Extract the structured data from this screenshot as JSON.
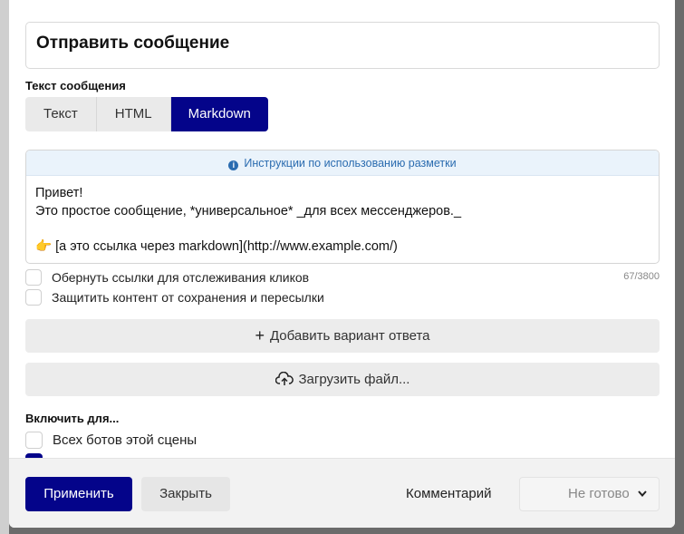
{
  "dialog": {
    "title": "Отправить сообщение"
  },
  "message": {
    "section_label": "Текст сообщения",
    "format_tabs": [
      {
        "label": "Текст",
        "active": false
      },
      {
        "label": "HTML",
        "active": false
      },
      {
        "label": "Markdown",
        "active": true
      }
    ],
    "hint": "Инструкции по использованию разметки",
    "body_lines": [
      "Привет!",
      "Это простое сообщение, *универсальное* _для всех мессенджеров._",
      "",
      "👉 [а это ссылка через markdown](http://www.example.com/)"
    ],
    "counter": "67/3800",
    "options": [
      {
        "label": "Обернуть ссылки для отслеживания кликов",
        "checked": false
      },
      {
        "label": "Защитить контент от сохранения и пересылки",
        "checked": false
      }
    ]
  },
  "actions": {
    "add_answer": "Добавить вариант ответа",
    "upload_file": "Загрузить файл..."
  },
  "include": {
    "section_label": "Включить для...",
    "options": [
      {
        "label": "Всех ботов этой сцены",
        "checked": false
      }
    ]
  },
  "footer": {
    "apply": "Применить",
    "close": "Закрыть",
    "comment": "Комментарий",
    "status": "Не готово"
  },
  "colors": {
    "accent": "#04048a",
    "hint_text": "#2b6cb0"
  }
}
